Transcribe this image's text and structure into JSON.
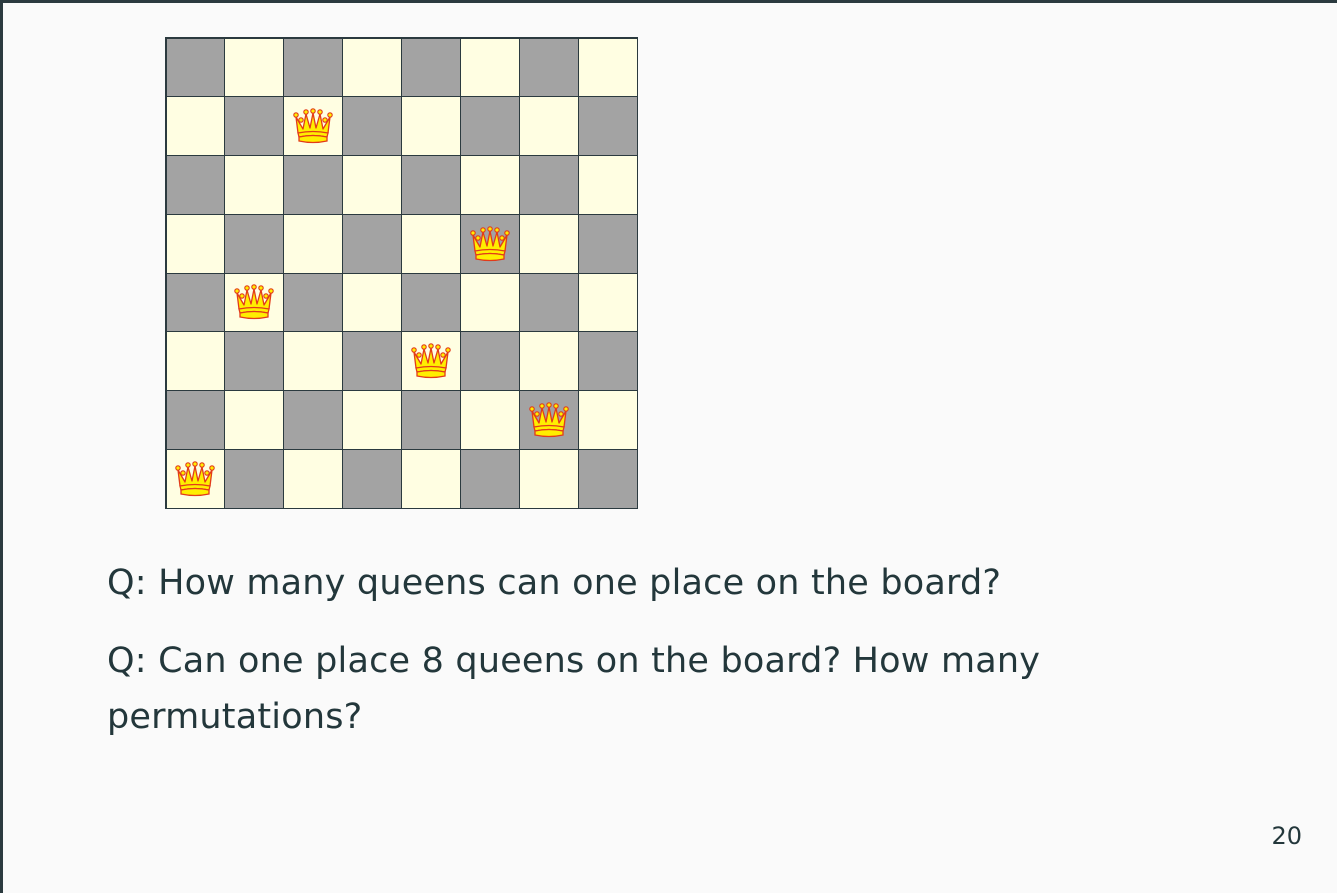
{
  "board": {
    "size": 8,
    "dark_color": "#a3a3a3",
    "light_color": "#fffee2",
    "queen_icon": "queen-crown-icon",
    "queen_color": "#ffee00",
    "queen_outline": "#e23b1a",
    "queens": [
      {
        "row": 2,
        "col": 3
      },
      {
        "row": 4,
        "col": 6
      },
      {
        "row": 5,
        "col": 2
      },
      {
        "row": 6,
        "col": 5
      },
      {
        "row": 7,
        "col": 7
      },
      {
        "row": 8,
        "col": 1
      }
    ]
  },
  "questions": {
    "q1": "Q: How many queens can one place on the board?",
    "q2": "Q: Can one place 8 queens on the board?  How many permutations?"
  },
  "page_number": "20"
}
